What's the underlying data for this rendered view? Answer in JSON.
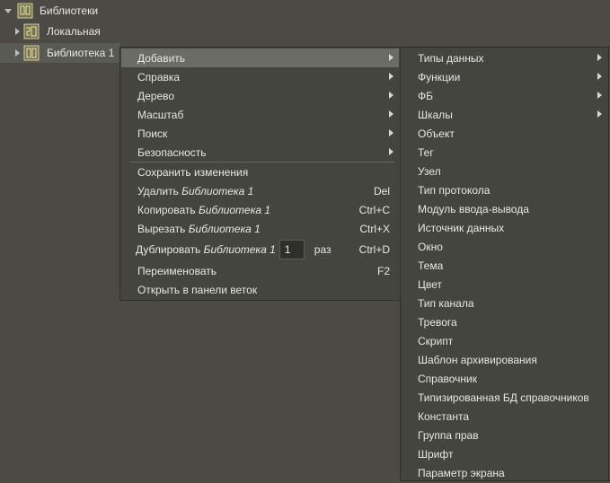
{
  "tree": {
    "root_label": "Библиотеки",
    "children": [
      {
        "label": "Локальная"
      },
      {
        "label": "Библиотека 1"
      }
    ]
  },
  "context_menu": {
    "submenu_items": [
      {
        "label": "Добавить"
      },
      {
        "label": "Справка"
      },
      {
        "label": "Дерево"
      },
      {
        "label": "Масштаб"
      },
      {
        "label": "Поиск"
      },
      {
        "label": "Безопасность"
      }
    ],
    "save": "Сохранить изменения",
    "delete": {
      "label": "Удалить",
      "target": "Библиотека 1",
      "shortcut": "Del"
    },
    "copy": {
      "label": "Копировать",
      "target": "Библиотека 1",
      "shortcut": "Ctrl+C"
    },
    "cut": {
      "label": "Вырезать",
      "target": "Библиотека 1",
      "shortcut": "Ctrl+X"
    },
    "duplicate": {
      "label": "Дублировать",
      "target": "Библиотека 1",
      "count": "1",
      "suffix": "раз",
      "shortcut": "Ctrl+D"
    },
    "rename": {
      "label": "Переименовать",
      "shortcut": "F2"
    },
    "open_panel": "Открыть в панели веток"
  },
  "add_submenu": {
    "items": [
      "Типы данных",
      "Функции",
      "ФБ",
      "Шкалы",
      "Объект",
      "Тег",
      "Узел",
      "Тип протокола",
      "Модуль ввода-вывода",
      "Источник данных",
      "Окно",
      "Тема",
      "Цвет",
      "Тип канала",
      "Тревога",
      "Скрипт",
      "Шаблон архивирования",
      "Справочник",
      "Типизированная БД справочников",
      "Константа",
      "Группа прав",
      "Шрифт",
      "Параметр экрана"
    ]
  },
  "colors": {
    "background": "#4b4a44",
    "menu": "#454540",
    "highlight": "#6c6c66",
    "icon": "#b8b08a"
  }
}
